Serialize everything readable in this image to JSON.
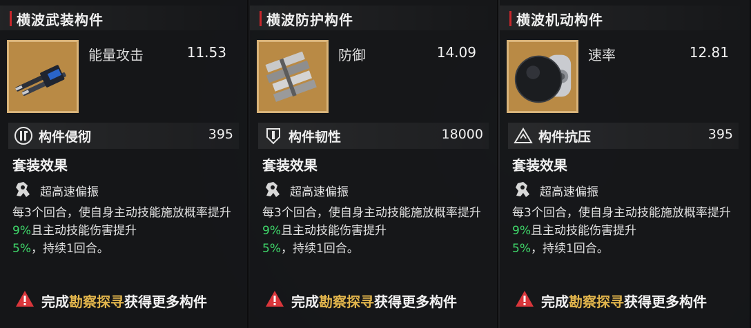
{
  "panels": [
    {
      "title": "横波武装构件",
      "stat_name": "能量攻击",
      "stat_value": "11.53",
      "attr_name": "构件侵彻",
      "attr_value": "395",
      "set_title": "套装效果",
      "effect_name": "超高速偏振",
      "desc_a": "每3个回合，使自身主动技能施放概率提升",
      "desc_hl1": "9%",
      "desc_b": "且主动技能伤害提升",
      "desc_hl2": "5%",
      "desc_c": "，持续1回合。",
      "footer_pre": "完成",
      "footer_link": "勘察探寻",
      "footer_post": "获得更多构件",
      "icon": "weapon-part-icon"
    },
    {
      "title": "横波防护构件",
      "stat_name": "防御",
      "stat_value": "14.09",
      "attr_name": "构件韧性",
      "attr_value": "18000",
      "set_title": "套装效果",
      "effect_name": "超高速偏振",
      "desc_a": "每3个回合，使自身主动技能施放概率提升",
      "desc_hl1": "9%",
      "desc_b": "且主动技能伤害提升",
      "desc_hl2": "5%",
      "desc_c": "，持续1回合。",
      "footer_pre": "完成",
      "footer_link": "勘察探寻",
      "footer_post": "获得更多构件",
      "icon": "armor-part-icon"
    },
    {
      "title": "横波机动构件",
      "stat_name": "速率",
      "stat_value": "12.81",
      "attr_name": "构件抗压",
      "attr_value": "395",
      "set_title": "套装效果",
      "effect_name": "超高速偏振",
      "desc_a": "每3个回合，使自身主动技能施放概率提升",
      "desc_hl1": "9%",
      "desc_b": "且主动技能伤害提升",
      "desc_hl2": "5%",
      "desc_c": "，持续1回合。",
      "footer_pre": "完成",
      "footer_link": "勘察探寻",
      "footer_post": "获得更多构件",
      "icon": "mobility-part-icon"
    }
  ],
  "colors": {
    "accent_red": "#c8262b",
    "highlight_green": "#3fd86a",
    "link_gold": "#e2b54c",
    "thumb_bg": "#b98a45"
  }
}
